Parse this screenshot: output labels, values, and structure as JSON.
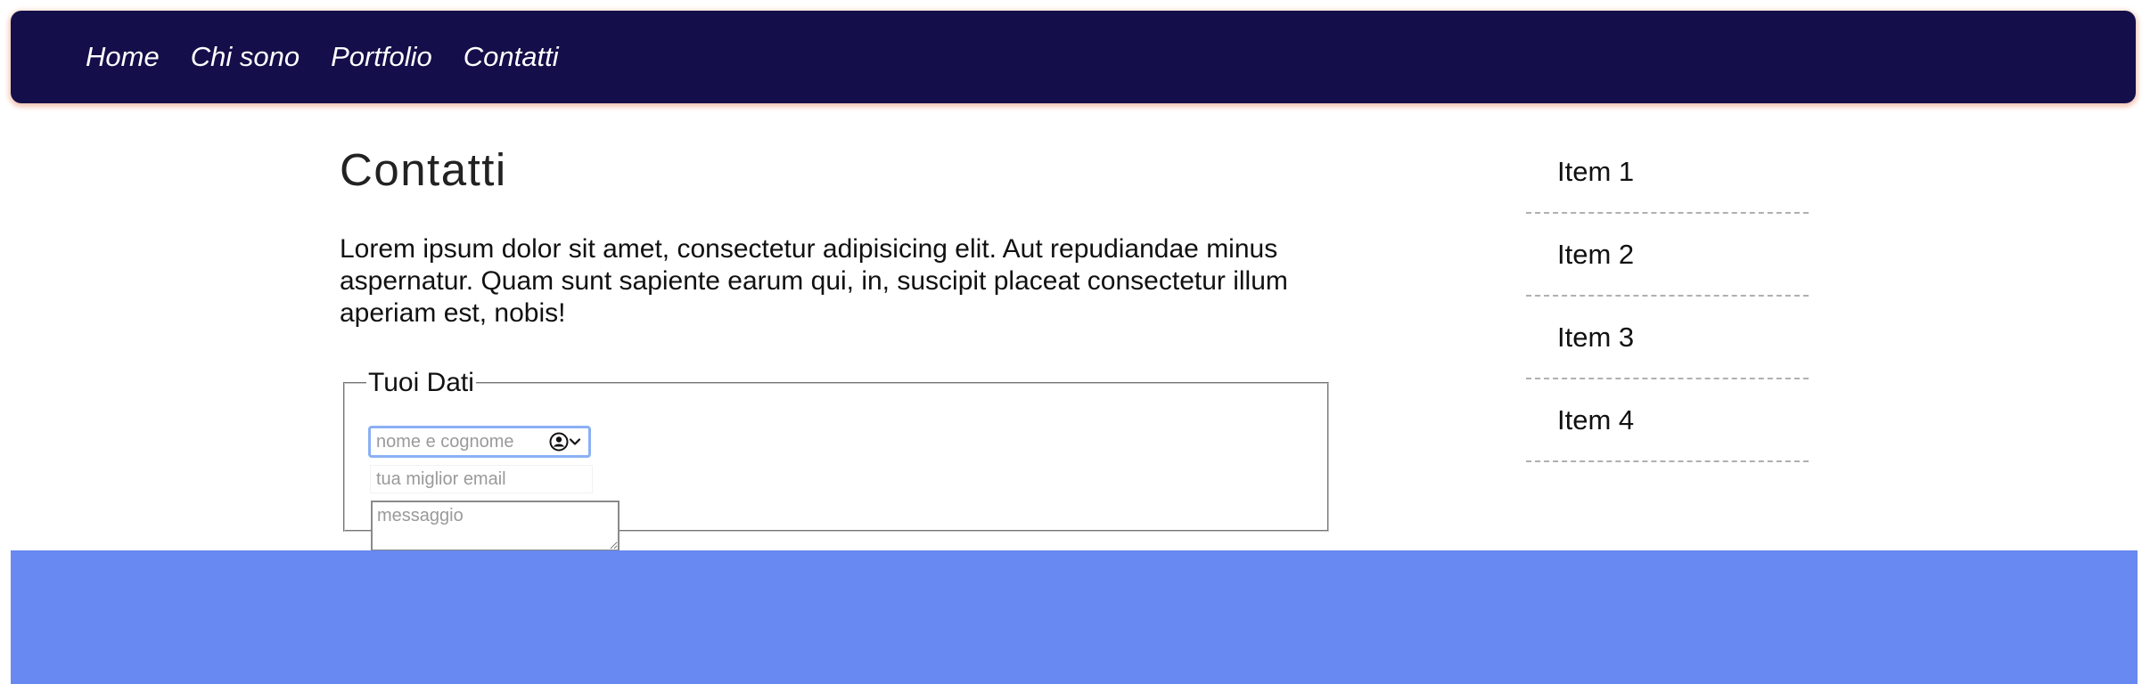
{
  "nav": {
    "items": [
      "Home",
      "Chi sono",
      "Portfolio",
      "Contatti"
    ]
  },
  "main": {
    "title": "Contatti",
    "intro": "Lorem ipsum dolor sit amet, consectetur adipisicing elit. Aut repudiandae minus aspernatur. Quam sunt sapiente earum qui, in, suscipit placeat consectetur illum aperiam est, nobis!"
  },
  "form": {
    "legend": "Tuoi Dati",
    "name_placeholder": "nome e cognome",
    "email_placeholder": "tua miglior email",
    "message_placeholder": "messaggio"
  },
  "sidebar": {
    "items": [
      "Item 1",
      "Item 2",
      "Item 3",
      "Item 4"
    ]
  },
  "icons": {
    "autofill": "contact-card-icon",
    "dropdown": "chevron-down-icon"
  },
  "colors": {
    "nav_background": "#140f4a",
    "footer_background": "#6888f2",
    "focus_ring": "#8ab0f5"
  }
}
